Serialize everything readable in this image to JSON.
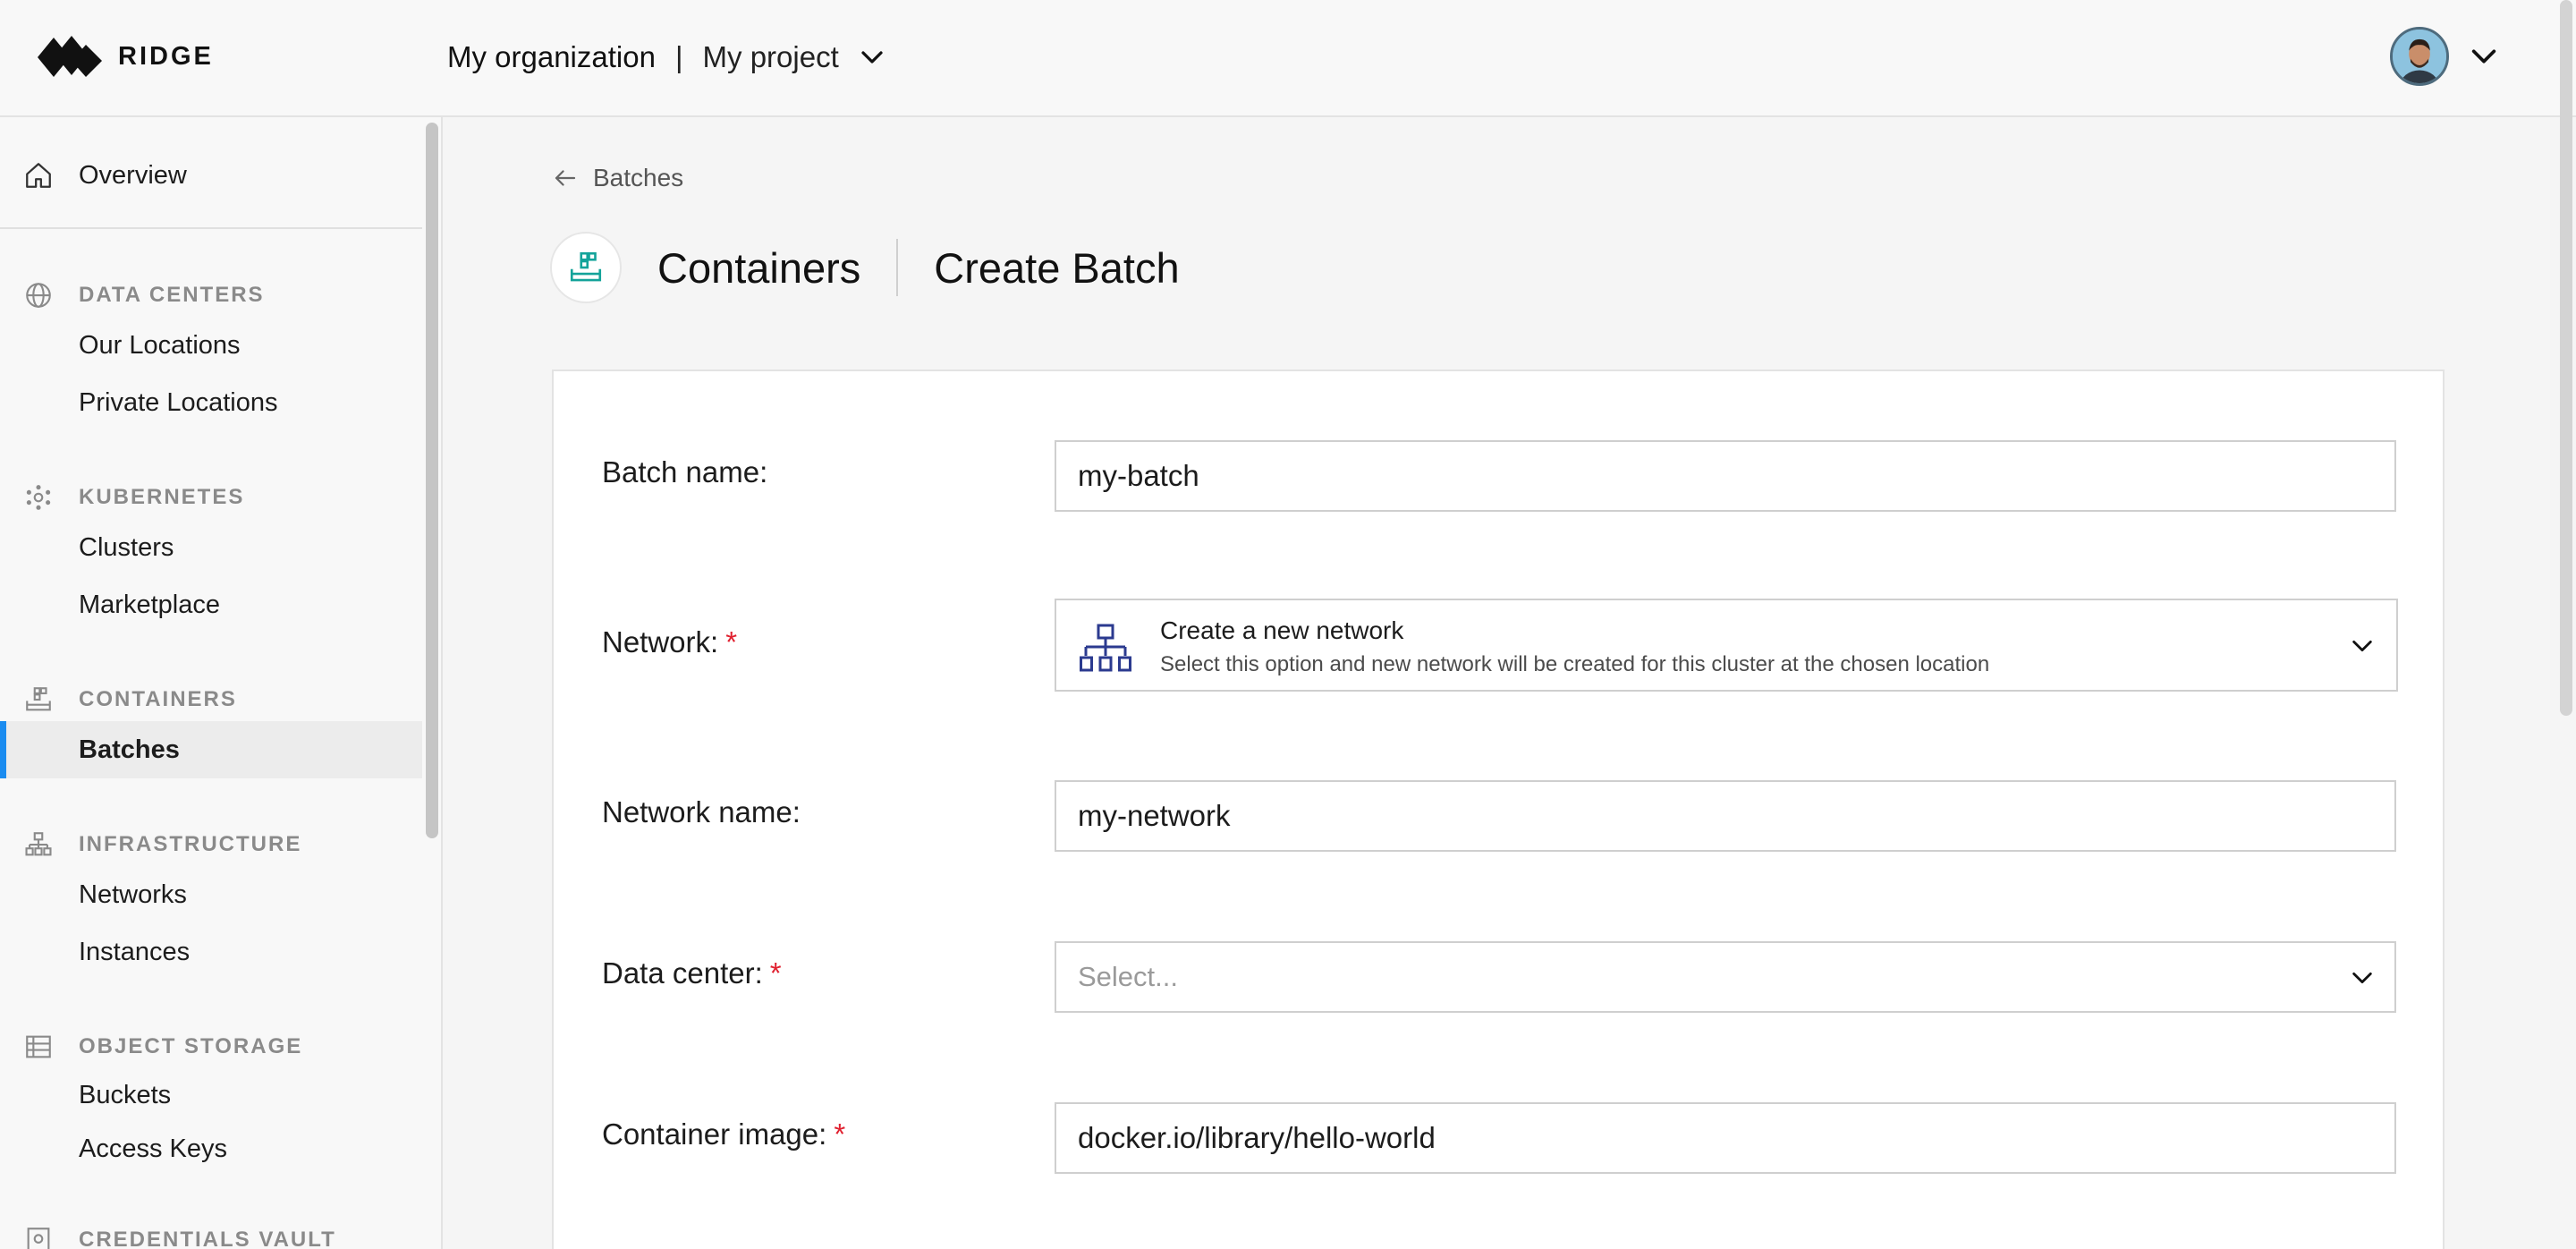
{
  "header": {
    "logo_text": "RIDGE",
    "org_name": "My organization",
    "separator": "|",
    "project_name": "My project"
  },
  "sidebar": {
    "overview": "Overview",
    "sections": [
      {
        "title": "DATA CENTERS",
        "icon": "globe-icon",
        "items": [
          "Our Locations",
          "Private Locations"
        ]
      },
      {
        "title": "KUBERNETES",
        "icon": "kubernetes-icon",
        "items": [
          "Clusters",
          "Marketplace"
        ]
      },
      {
        "title": "CONTAINERS",
        "icon": "containers-icon",
        "items": [
          "Batches"
        ]
      },
      {
        "title": "INFRASTRUCTURE",
        "icon": "network-icon",
        "items": [
          "Networks",
          "Instances"
        ]
      },
      {
        "title": "OBJECT STORAGE",
        "icon": "storage-icon",
        "items": [
          "Buckets",
          "Access Keys"
        ]
      },
      {
        "title": "CREDENTIALS VAULT",
        "icon": "vault-icon",
        "items": []
      }
    ],
    "active_item": "Batches",
    "accent_color": "#1a8cf0"
  },
  "main": {
    "back_label": "Batches",
    "title": "Containers",
    "subtitle": "Create Batch",
    "form": {
      "batch_name": {
        "label": "Batch name:",
        "value": "my-batch"
      },
      "network": {
        "label": "Network:",
        "required": "*",
        "option_title": "Create a new network",
        "option_desc": "Select this option and new network will be created for this cluster at the chosen location"
      },
      "network_name": {
        "label": "Network name:",
        "value": "my-network"
      },
      "data_center": {
        "label": "Data center:",
        "required": "*",
        "placeholder": "Select..."
      },
      "container_image": {
        "label": "Container image:",
        "required": "*",
        "value": "docker.io/library/hello-world"
      }
    }
  },
  "colors": {
    "required": "#e0202f",
    "network_icon": "#2b3a8f",
    "container_icon": "#14a39a"
  }
}
